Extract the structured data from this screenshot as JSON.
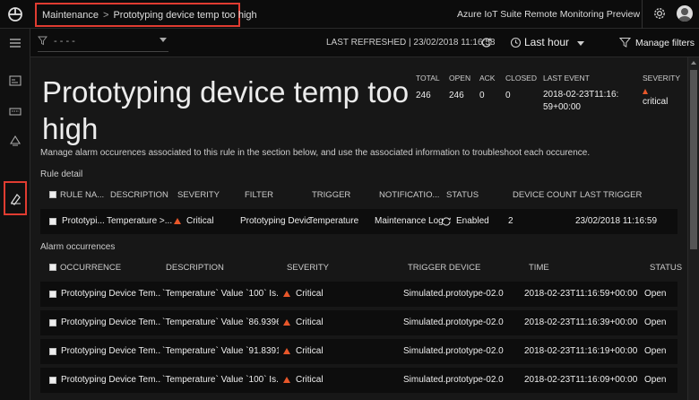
{
  "breadcrumb": {
    "parent": "Maintenance",
    "separator": ">",
    "current": "Prototyping device temp too high"
  },
  "app_title": "Azure IoT Suite Remote Monitoring Preview",
  "filter": {
    "value": "- - - -"
  },
  "last_refreshed": "LAST REFRESHED | 23/02/2018 11:16:58",
  "time_range": "Last hour",
  "manage_filters": "Manage filters",
  "page_title": "Prototyping device temp too high",
  "stats": [
    {
      "label": "TOTAL",
      "value": "246"
    },
    {
      "label": "OPEN",
      "value": "246"
    },
    {
      "label": "ACK",
      "value": "0"
    },
    {
      "label": "CLOSED",
      "value": "0"
    },
    {
      "label": "LAST EVENT",
      "value": "2018-02-23T11:16:59+00:00"
    },
    {
      "label": "SEVERITY",
      "value": "critical"
    }
  ],
  "description": "Manage alarm occurences associated to this rule in the section below, and use the associated information to troubleshoot each occurence.",
  "rule_detail": {
    "title": "Rule detail",
    "columns": [
      "RULE NA...",
      "DESCRIPTION",
      "SEVERITY",
      "FILTER",
      "TRIGGER",
      "NOTIFICATIO...",
      "STATUS",
      "DEVICE COUNT",
      "LAST TRIGGER"
    ],
    "row": {
      "name": "Prototypi...",
      "description": "Temperature >...",
      "severity": "Critical",
      "filter": "Prototyping Devic",
      "trigger": "Temperature",
      "notification": "Maintenance Log",
      "status": "Enabled",
      "device_count": "2",
      "last_trigger": "23/02/2018 11:16:59"
    }
  },
  "alarms": {
    "title": "Alarm occurrences",
    "columns": [
      "OCCURRENCE",
      "DESCRIPTION",
      "SEVERITY",
      "TRIGGER DEVICE",
      "TIME",
      "STATUS"
    ],
    "rows": [
      {
        "occurrence": "Prototyping Device Tem...",
        "description": "`Temperature` Value `100` Is...",
        "severity": "Critical",
        "device": "Simulated.prototype-02.0",
        "time": "2018-02-23T11:16:59+00:00",
        "status": "Open"
      },
      {
        "occurrence": "Prototyping Device Tem...",
        "description": "`Temperature` Value `86.9396...",
        "severity": "Critical",
        "device": "Simulated.prototype-02.0",
        "time": "2018-02-23T11:16:39+00:00",
        "status": "Open"
      },
      {
        "occurrence": "Prototyping Device Tem...",
        "description": "`Temperature` Value `91.8391...",
        "severity": "Critical",
        "device": "Simulated.prototype-02.0",
        "time": "2018-02-23T11:16:19+00:00",
        "status": "Open"
      },
      {
        "occurrence": "Prototyping Device Tem...",
        "description": "`Temperature` Value `100` Is...",
        "severity": "Critical",
        "device": "Simulated.prototype-02.0",
        "time": "2018-02-23T11:16:09+00:00",
        "status": "Open"
      }
    ]
  },
  "colors": {
    "accent_red": "#e03c31",
    "critical": "#e8572a",
    "background": "#171717"
  },
  "icons": [
    "logo-icon",
    "gear-icon",
    "avatar",
    "hamburger-icon",
    "dashboard-icon",
    "devices-icon",
    "rules-icon",
    "maintenance-icon",
    "filter-icon",
    "refresh-icon",
    "clock-icon",
    "manage-filters-icon",
    "warning-triangle-icon",
    "sync-icon"
  ]
}
